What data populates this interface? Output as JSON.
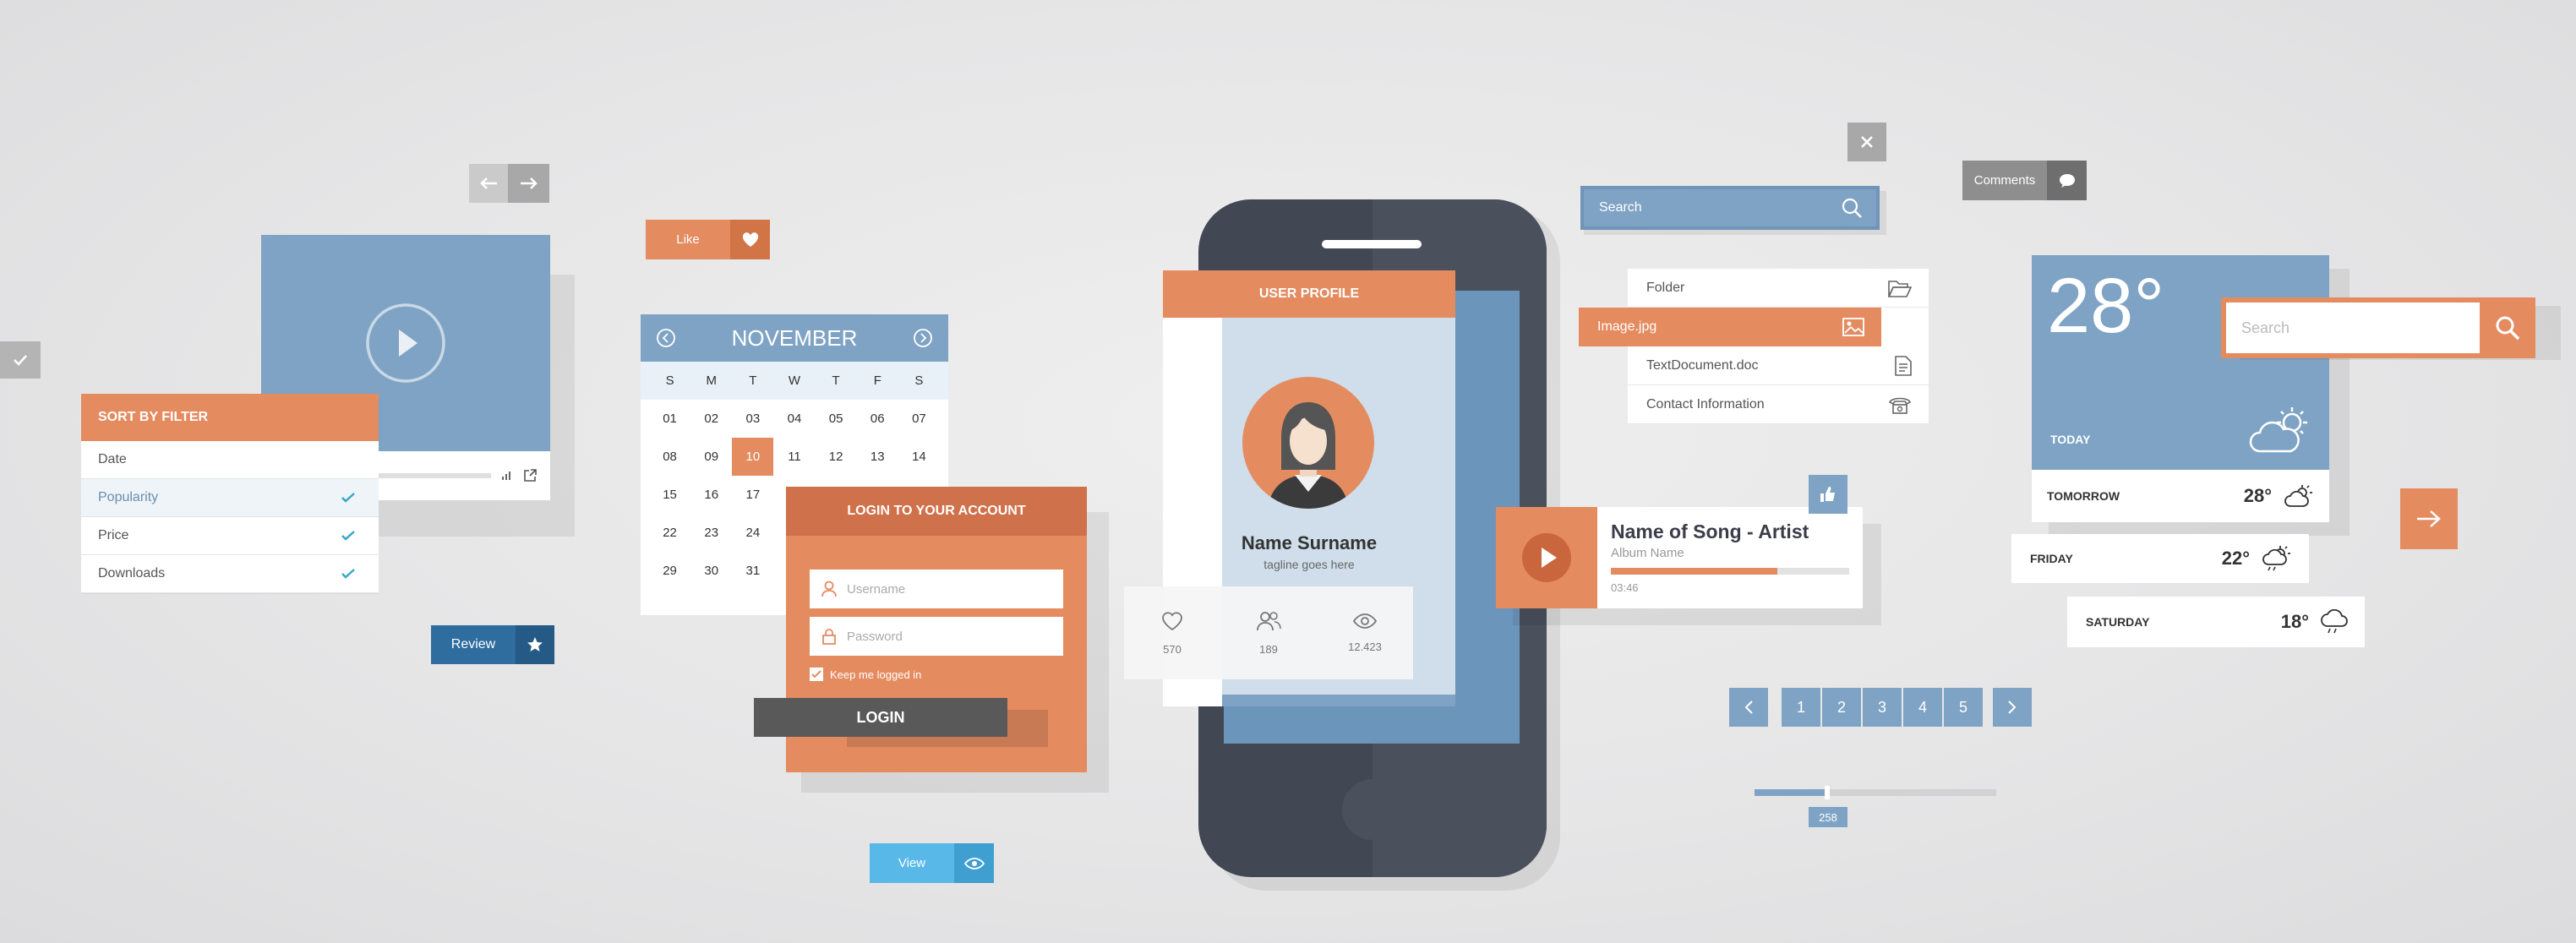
{
  "colors": {
    "orange": "#e48b60",
    "blue": "#7fa3c4",
    "dark_blue": "#2e6d9e",
    "gray": "#b4b4b4",
    "dark_gray": "#595959",
    "cyan": "#58b9e8",
    "phone": "#414753"
  },
  "nav_arrows": {
    "back_icon": "arrow-left-icon",
    "forward_icon": "arrow-right-icon"
  },
  "checkbox_tile": {
    "icon": "check-icon"
  },
  "video_player": {
    "play_icon": "play-icon",
    "progress": 0.4,
    "volume_icon": "volume-icon",
    "fullscreen_icon": "external-link-icon"
  },
  "sort_filter": {
    "title": "SORT BY FILTER",
    "items": [
      {
        "label": "Date",
        "checked": false
      },
      {
        "label": "Popularity",
        "checked": true
      },
      {
        "label": "Price",
        "checked": true
      },
      {
        "label": "Downloads",
        "checked": true
      }
    ]
  },
  "review_button": {
    "label": "Review",
    "icon": "star-icon"
  },
  "like_button": {
    "label": "Like",
    "icon": "heart-icon"
  },
  "calendar": {
    "month": "NOVEMBER",
    "weekdays": [
      "S",
      "M",
      "T",
      "W",
      "T",
      "F",
      "S"
    ],
    "weeks": [
      [
        "01",
        "02",
        "03",
        "04",
        "05",
        "06",
        "07"
      ],
      [
        "08",
        "09",
        "10",
        "11",
        "12",
        "13",
        "14"
      ],
      [
        "15",
        "16",
        "17",
        "",
        "",
        "",
        ""
      ],
      [
        "22",
        "23",
        "24",
        "",
        "",
        "",
        ""
      ],
      [
        "29",
        "30",
        "31",
        "",
        "",
        "",
        ""
      ]
    ],
    "selected": "10"
  },
  "login": {
    "title": "LOGIN TO YOUR ACCOUNT",
    "username_placeholder": "Username",
    "password_placeholder": "Password",
    "remember_label": "Keep me logged in",
    "button_label": "LOGIN"
  },
  "view_button": {
    "label": "View",
    "icon": "eye-icon"
  },
  "profile": {
    "header": "USER PROFILE",
    "name": "Name Surname",
    "tagline": "tagline goes here",
    "stats": [
      {
        "icon": "heart-icon",
        "value": "570"
      },
      {
        "icon": "users-icon",
        "value": "189"
      },
      {
        "icon": "eye-icon",
        "value": "12.423"
      }
    ]
  },
  "close_button": {
    "icon": "close-icon"
  },
  "search_bar": {
    "placeholder": "Search",
    "icon": "search-icon"
  },
  "files": [
    {
      "label": "Folder",
      "icon": "folder-icon"
    },
    {
      "label": "Image.jpg",
      "icon": "image-icon",
      "selected": true
    },
    {
      "label": "TextDocument.doc",
      "icon": "document-icon"
    },
    {
      "label": "Contact Information",
      "icon": "phone-icon"
    }
  ],
  "music": {
    "song": "Name of Song - Artist",
    "album": "Album Name",
    "time": "03:46",
    "progress": 0.7,
    "like_icon": "thumbs-up-icon"
  },
  "pagination": {
    "pages": [
      "1",
      "2",
      "3",
      "4",
      "5"
    ],
    "prev_icon": "chevron-left-icon",
    "next_icon": "chevron-right-icon"
  },
  "slider": {
    "value": "258",
    "fraction": 0.3
  },
  "comments_button": {
    "label": "Comments",
    "icon": "chat-icon"
  },
  "weather": {
    "temp": "28°",
    "today_label": "TODAY",
    "search_placeholder": "Search",
    "forecast": [
      {
        "day": "TOMORROW",
        "temp": "28°",
        "icon": "sun-cloud-icon"
      },
      {
        "day": "FRIDAY",
        "temp": "22°",
        "icon": "sun-cloud-rain-icon"
      },
      {
        "day": "SATURDAY",
        "temp": "18°",
        "icon": "cloud-rain-icon"
      }
    ]
  },
  "next_arrow": {
    "icon": "arrow-right-icon"
  }
}
